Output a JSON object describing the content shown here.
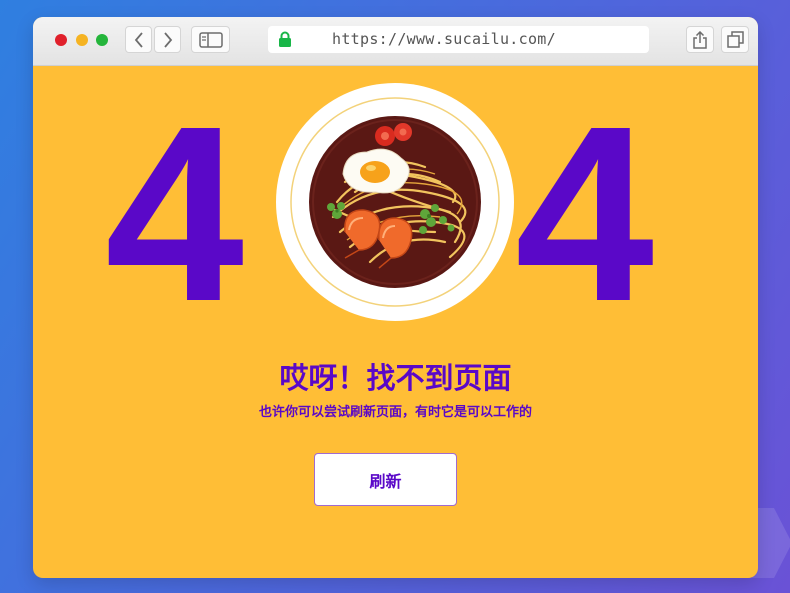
{
  "browser": {
    "url": "https://www.sucailu.com/",
    "icons": {
      "back": "chevron-left-icon",
      "forward": "chevron-right-icon",
      "sidebar": "sidebar-icon",
      "lock": "lock-icon",
      "share": "share-icon",
      "tabs": "tabs-icon"
    }
  },
  "error_page": {
    "digit_left": "4",
    "digit_right": "4",
    "title": "哎呀！找不到页面",
    "subtitle": "也许你可以尝试刷新页面，有时它是可以工作的",
    "refresh_label": "刷新"
  },
  "colors": {
    "background": "#ffbe36",
    "accent": "#5a08c8",
    "button_bg": "#ffffff"
  }
}
